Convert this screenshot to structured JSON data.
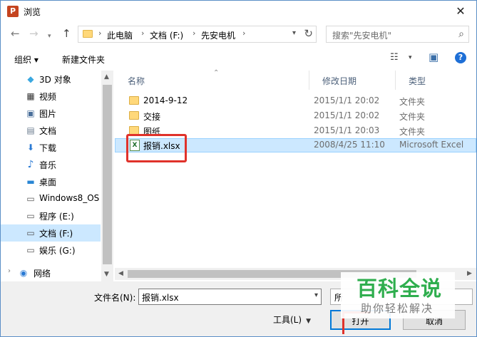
{
  "window": {
    "title": "浏览",
    "app_icon": "P"
  },
  "address": {
    "segments": [
      "此电脑",
      "文档 (F:)",
      "先安电机"
    ],
    "separator": "›"
  },
  "search": {
    "placeholder": "搜索\"先安电机\""
  },
  "toolbar": {
    "organize": "组织 ▾",
    "new_folder": "新建文件夹"
  },
  "nav_pane": {
    "items": [
      {
        "label": "3D 对象",
        "icon": "cube-icon",
        "glyph": "◆"
      },
      {
        "label": "视频",
        "icon": "video-icon",
        "glyph": "▦"
      },
      {
        "label": "图片",
        "icon": "picture-icon",
        "glyph": "▣"
      },
      {
        "label": "文档",
        "icon": "document-icon",
        "glyph": "▤"
      },
      {
        "label": "下载",
        "icon": "download-icon",
        "glyph": "⬇"
      },
      {
        "label": "音乐",
        "icon": "music-icon",
        "glyph": "♪"
      },
      {
        "label": "桌面",
        "icon": "desktop-icon",
        "glyph": "▬"
      },
      {
        "label": "Windows8_OS",
        "icon": "drive-icon",
        "glyph": "▭"
      },
      {
        "label": "程序 (E:)",
        "icon": "drive-icon",
        "glyph": "▭"
      },
      {
        "label": "文档 (F:)",
        "icon": "drive-icon",
        "glyph": "▭"
      },
      {
        "label": "娱乐 (G:)",
        "icon": "drive-icon",
        "glyph": "▭"
      },
      {
        "label": "网络",
        "icon": "network-icon",
        "glyph": "◉"
      }
    ],
    "selected_index": 9
  },
  "columns": {
    "name": "名称",
    "date": "修改日期",
    "type": "类型"
  },
  "files": [
    {
      "name": "2014-9-12",
      "date": "2015/1/1 20:02",
      "type": "文件夹",
      "kind": "folder"
    },
    {
      "name": "交接",
      "date": "2015/1/1 20:02",
      "type": "文件夹",
      "kind": "folder"
    },
    {
      "name": "图纸",
      "date": "2015/1/1 20:03",
      "type": "文件夹",
      "kind": "folder"
    },
    {
      "name": "报销.xlsx",
      "date": "2008/4/25 11:10",
      "type": "Microsoft Excel",
      "kind": "xlsx"
    }
  ],
  "bottom": {
    "filename_label": "文件名(N):",
    "filename_value": "报销.xlsx",
    "filter_label": "所",
    "tools_label": "工具(L)",
    "open_label": "打开",
    "cancel_label": "取消"
  },
  "watermark": {
    "title": "百科全说",
    "subtitle": "助你轻松解决"
  },
  "colors": {
    "selected_bg": "#cce8ff",
    "highlight_red": "#e0322b",
    "watermark_green": "#2fae4e"
  }
}
